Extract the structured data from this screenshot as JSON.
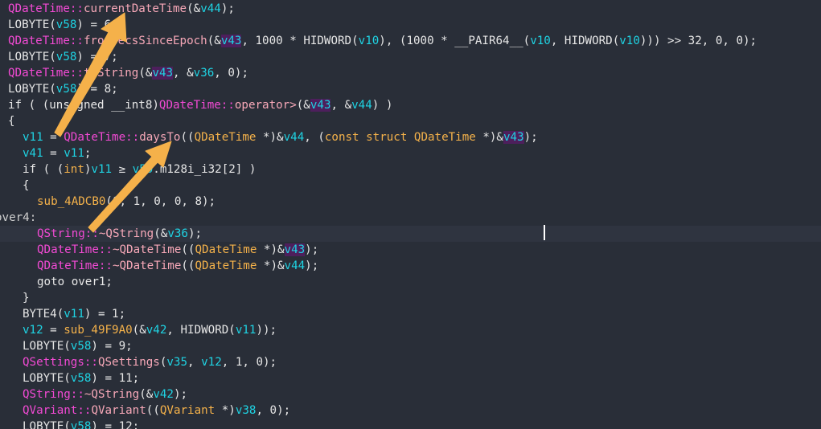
{
  "lines": [
    {
      "indent": 10,
      "tokens": [
        [
          "QDateTime",
          "class"
        ],
        [
          "::",
          "class"
        ],
        [
          "currentDateTime",
          "func"
        ],
        [
          "(&",
          "plain"
        ],
        [
          "v44",
          "var"
        ],
        [
          ");",
          "plain"
        ]
      ]
    },
    {
      "indent": 10,
      "tokens": [
        [
          "LOBYTE",
          "plain"
        ],
        [
          "(",
          "plain"
        ],
        [
          "v58",
          "var"
        ],
        [
          ") = 6",
          "plain"
        ],
        [
          ";",
          "plain"
        ]
      ]
    },
    {
      "indent": 10,
      "tokens": [
        [
          "QDateTime",
          "class"
        ],
        [
          "::",
          "class"
        ],
        [
          "fromSecsSinceEpoch",
          "func"
        ],
        [
          "(&",
          "plain"
        ],
        [
          "v43",
          "varhl"
        ],
        [
          ", 1000 * ",
          "plain"
        ],
        [
          "HIDWORD",
          "plain"
        ],
        [
          "(",
          "plain"
        ],
        [
          "v10",
          "var"
        ],
        [
          "), (1000 * __PAIR64__(",
          "plain"
        ],
        [
          "v10",
          "var"
        ],
        [
          ", ",
          "plain"
        ],
        [
          "HIDWORD",
          "plain"
        ],
        [
          "(",
          "plain"
        ],
        [
          "v10",
          "var"
        ],
        [
          "))) >> 32, 0, 0);",
          "plain"
        ]
      ]
    },
    {
      "indent": 10,
      "tokens": [
        [
          "LOBYTE",
          "plain"
        ],
        [
          "(",
          "plain"
        ],
        [
          "v58",
          "var"
        ],
        [
          ") = 7",
          "plain"
        ],
        [
          ";",
          "plain"
        ]
      ]
    },
    {
      "indent": 10,
      "tokens": [
        [
          "QDateTime",
          "class"
        ],
        [
          "::",
          "class"
        ],
        [
          "toString",
          "func"
        ],
        [
          "(&",
          "plain"
        ],
        [
          "v43",
          "varhl"
        ],
        [
          ", &",
          "plain"
        ],
        [
          "v36",
          "var"
        ],
        [
          ", 0);",
          "plain"
        ]
      ]
    },
    {
      "indent": 10,
      "tokens": [
        [
          "LOBYTE",
          "plain"
        ],
        [
          "(",
          "plain"
        ],
        [
          "v58",
          "var"
        ],
        [
          ") = 8;",
          "plain"
        ]
      ]
    },
    {
      "indent": 10,
      "tokens": [
        [
          "if ( (unsigned __int8)",
          "kw"
        ],
        [
          "QDateTime",
          "class"
        ],
        [
          "::",
          "class"
        ],
        [
          "operator>",
          "func"
        ],
        [
          "(&",
          "plain"
        ],
        [
          "v43",
          "varhl"
        ],
        [
          ", &",
          "plain"
        ],
        [
          "v44",
          "var"
        ],
        [
          ") )",
          "plain"
        ]
      ]
    },
    {
      "indent": 10,
      "tokens": [
        [
          "{",
          "plain"
        ]
      ]
    },
    {
      "indent": 28,
      "tokens": [
        [
          "v11",
          "var"
        ],
        [
          " = ",
          "plain"
        ],
        [
          "QDateTime",
          "class"
        ],
        [
          "::",
          "class"
        ],
        [
          "daysTo",
          "func"
        ],
        [
          "((",
          "plain"
        ],
        [
          "QDateTime",
          "type"
        ],
        [
          " *)&",
          "plain"
        ],
        [
          "v44",
          "var"
        ],
        [
          ", (",
          "plain"
        ],
        [
          "const struct ",
          "type"
        ],
        [
          "QDateTime",
          "type"
        ],
        [
          " *)&",
          "plain"
        ],
        [
          "v43",
          "varhl"
        ],
        [
          ");",
          "plain"
        ]
      ]
    },
    {
      "indent": 28,
      "tokens": [
        [
          "v41",
          "var"
        ],
        [
          " = ",
          "plain"
        ],
        [
          "v11",
          "var"
        ],
        [
          ";",
          "plain"
        ]
      ]
    },
    {
      "indent": 28,
      "tokens": [
        [
          "if ( (",
          "kw"
        ],
        [
          "int",
          "type"
        ],
        [
          ")",
          "plain"
        ],
        [
          "v11",
          "var"
        ],
        [
          " ≥ ",
          "plain"
        ],
        [
          "v50",
          "var"
        ],
        [
          ".m128i_i32[2] )",
          "plain"
        ]
      ]
    },
    {
      "indent": 28,
      "tokens": [
        [
          "{",
          "plain"
        ]
      ]
    },
    {
      "indent": 46,
      "tokens": [
        [
          "sub_4ADCB0",
          "fn2"
        ],
        [
          "(0, 1, 0, 0, 8);",
          "plain"
        ]
      ]
    },
    {
      "indent": -6,
      "tokens": [
        [
          "over4:",
          "label"
        ]
      ]
    },
    {
      "indent": 46,
      "tokens": [
        [
          "QString",
          "class"
        ],
        [
          "::",
          "class"
        ],
        [
          "~QString",
          "func"
        ],
        [
          "(&",
          "plain"
        ],
        [
          "v36",
          "var"
        ],
        [
          ");",
          "plain"
        ]
      ],
      "highlight": true
    },
    {
      "indent": 46,
      "tokens": [
        [
          "QDateTime",
          "class"
        ],
        [
          "::",
          "class"
        ],
        [
          "~QDateTime",
          "func"
        ],
        [
          "((",
          "plain"
        ],
        [
          "QDateTime",
          "type"
        ],
        [
          " *)&",
          "plain"
        ],
        [
          "v43",
          "varhl"
        ],
        [
          ");",
          "plain"
        ]
      ]
    },
    {
      "indent": 46,
      "tokens": [
        [
          "QDateTime",
          "class"
        ],
        [
          "::",
          "class"
        ],
        [
          "~QDateTime",
          "func"
        ],
        [
          "((",
          "plain"
        ],
        [
          "QDateTime",
          "type"
        ],
        [
          " *)&",
          "plain"
        ],
        [
          "v44",
          "var"
        ],
        [
          ");",
          "plain"
        ]
      ]
    },
    {
      "indent": 46,
      "tokens": [
        [
          "goto over1;",
          "kw"
        ]
      ]
    },
    {
      "indent": 28,
      "tokens": [
        [
          "}",
          "plain"
        ]
      ]
    },
    {
      "indent": 28,
      "tokens": [
        [
          "BYTE4",
          "plain"
        ],
        [
          "(",
          "plain"
        ],
        [
          "v11",
          "var"
        ],
        [
          ") = 1;",
          "plain"
        ]
      ]
    },
    {
      "indent": 28,
      "tokens": [
        [
          "v12",
          "var"
        ],
        [
          " = ",
          "plain"
        ],
        [
          "sub_49F9A0",
          "fn2"
        ],
        [
          "(&",
          "plain"
        ],
        [
          "v42",
          "var"
        ],
        [
          ", ",
          "plain"
        ],
        [
          "HIDWORD",
          "plain"
        ],
        [
          "(",
          "plain"
        ],
        [
          "v11",
          "var"
        ],
        [
          "));",
          "plain"
        ]
      ]
    },
    {
      "indent": 28,
      "tokens": [
        [
          "LOBYTE",
          "plain"
        ],
        [
          "(",
          "plain"
        ],
        [
          "v58",
          "var"
        ],
        [
          ") = 9;",
          "plain"
        ]
      ]
    },
    {
      "indent": 28,
      "tokens": [
        [
          "QSettings",
          "class"
        ],
        [
          "::",
          "class"
        ],
        [
          "QSettings",
          "func"
        ],
        [
          "(",
          "plain"
        ],
        [
          "v35",
          "var"
        ],
        [
          ", ",
          "plain"
        ],
        [
          "v12",
          "var"
        ],
        [
          ", 1, 0);",
          "plain"
        ]
      ]
    },
    {
      "indent": 28,
      "tokens": [
        [
          "LOBYTE",
          "plain"
        ],
        [
          "(",
          "plain"
        ],
        [
          "v58",
          "var"
        ],
        [
          ") = 11;",
          "plain"
        ]
      ]
    },
    {
      "indent": 28,
      "tokens": [
        [
          "QString",
          "class"
        ],
        [
          "::",
          "class"
        ],
        [
          "~QString",
          "func"
        ],
        [
          "(&",
          "plain"
        ],
        [
          "v42",
          "var"
        ],
        [
          ");",
          "plain"
        ]
      ]
    },
    {
      "indent": 28,
      "tokens": [
        [
          "QVariant",
          "class"
        ],
        [
          "::",
          "class"
        ],
        [
          "QVariant",
          "func"
        ],
        [
          "((",
          "plain"
        ],
        [
          "QVariant",
          "type"
        ],
        [
          " *)",
          "plain"
        ],
        [
          "v38",
          "var"
        ],
        [
          ", 0);",
          "plain"
        ]
      ]
    },
    {
      "indent": 28,
      "tokens": [
        [
          "LOBYTE",
          "plain"
        ],
        [
          "(",
          "plain"
        ],
        [
          "v58",
          "var"
        ],
        [
          ") = 12;",
          "plain"
        ]
      ]
    }
  ],
  "colors": {
    "background": "#292e38",
    "class": "#f24ad4",
    "variable": "#1fd3e3",
    "type": "#f5b24a",
    "arrow": "#f5b14a"
  }
}
